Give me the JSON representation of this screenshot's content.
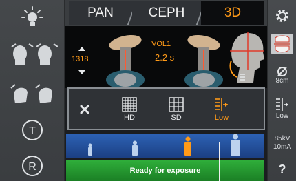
{
  "tabs": {
    "pan": "PAN",
    "ceph": "CEPH",
    "threed": "3D",
    "active": "3D"
  },
  "preview": {
    "volume": "VOL1",
    "time": "2.2 s",
    "height": "1318"
  },
  "popup": {
    "hd": "HD",
    "sd": "SD",
    "low": "Low",
    "selected": "Low"
  },
  "status": {
    "ready": "Ready for exposure"
  },
  "right": {
    "fov": "8cm",
    "resolution": "Low",
    "kv": "85kV",
    "ma": "10mA",
    "help": "?"
  },
  "left": {
    "t_label": "T",
    "r_label": "R"
  },
  "patient": {
    "selected_size": "adult-medium"
  },
  "colors": {
    "accent": "#ff9a18",
    "ready": "#2fae3a",
    "patient_bar": "#2d62b5"
  },
  "icons": {
    "left": [
      "light-icon",
      "head-position-front-icon",
      "head-position-side-icon",
      "t-circle-icon",
      "r-circle-icon"
    ],
    "right": [
      "settings-gear-icon",
      "dental-arch-icon",
      "diameter-icon",
      "resolution-icon",
      "help-icon"
    ]
  }
}
